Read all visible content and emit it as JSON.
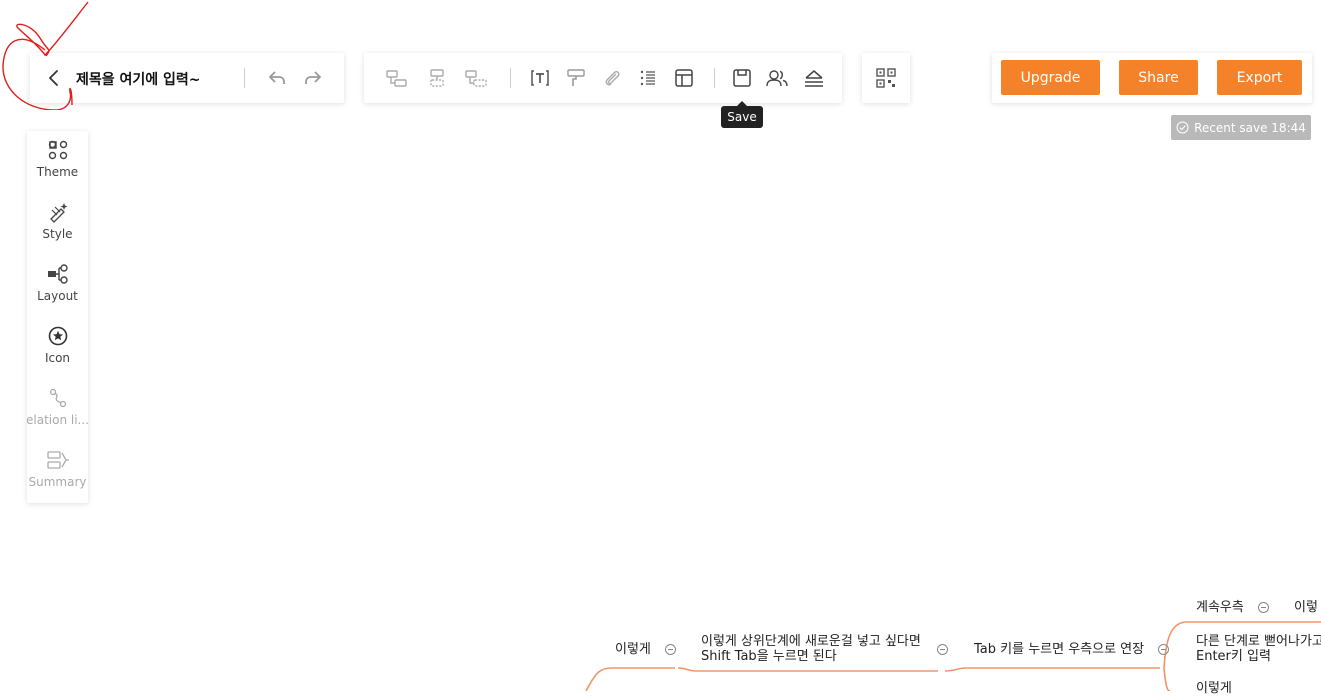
{
  "header": {
    "title": "제목을 여기에 입력~"
  },
  "toolbar": {
    "tooltip": "Save",
    "icons": [
      "subtopic-icon",
      "sibling-topic-icon",
      "parent-topic-icon",
      "text-icon",
      "format-painter-icon",
      "attachment-icon",
      "list-icon",
      "layout-panel-icon",
      "save-icon",
      "collaborate-icon",
      "outline-icon",
      "qr-code-icon"
    ]
  },
  "actions": {
    "upgrade": "Upgrade",
    "share": "Share",
    "export": "Export",
    "accent": "#f58229"
  },
  "save_status": {
    "text": "Recent save 18:44"
  },
  "sidebar": {
    "items": [
      {
        "label": "Theme"
      },
      {
        "label": "Style"
      },
      {
        "label": "Layout"
      },
      {
        "label": "Icon"
      },
      {
        "label": "elation li..."
      },
      {
        "label": "Summary"
      }
    ]
  },
  "mindmap": {
    "line_color": "#f0956a",
    "nodes": {
      "n1": "이렇게",
      "n2_line1": "이렇게 상위단계에 새로운걸 넣고 싶다면",
      "n2_line2": "Shift Tab을 누르면 된다",
      "n3": "Tab 키를 누르면 우측으로 연장",
      "n4": "계속우측",
      "n5": "이렇",
      "n6_line1": "다른 단계로 뻗어나가고",
      "n6_line2": "Enter키 입력",
      "n7": "이렇게"
    }
  }
}
